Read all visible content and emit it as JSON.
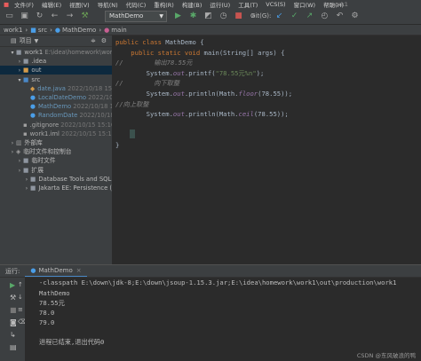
{
  "menubar": {
    "items": [
      "文件(F)",
      "编辑(E)",
      "视图(V)",
      "导航(N)",
      "代码(C)",
      "重构(R)",
      "构建(B)",
      "运行(U)",
      "工具(T)",
      "VCS(S)",
      "窗口(W)",
      "帮助(H)"
    ],
    "window_title": "work1"
  },
  "toolbar": {
    "run_config": "MathDemo",
    "git_label": "Git(G):"
  },
  "breadcrumbs": [
    "work1",
    "src",
    "MathDemo",
    "main"
  ],
  "project": {
    "header": "项目",
    "tree": [
      {
        "label": "work1",
        "path": "E:\\idea\\homework\\work1",
        "indent": 0,
        "icon": "folder",
        "expanded": true
      },
      {
        "label": ".idea",
        "indent": 1,
        "icon": "folder"
      },
      {
        "label": "out",
        "indent": 1,
        "icon": "folder-orange",
        "selected": true
      },
      {
        "label": "src",
        "indent": 1,
        "icon": "folder-blue",
        "expanded": true
      },
      {
        "label": "date.java",
        "meta": "2022/10/18 15:21 2.7",
        "indent": 2,
        "icon": "java-file"
      },
      {
        "label": "LocalDateDemo",
        "meta": "2022/10/18 15:21 2.7",
        "indent": 2,
        "icon": "class"
      },
      {
        "label": "MathDemo",
        "meta": "2022/10/18 15:16, 1.2",
        "indent": 2,
        "icon": "class"
      },
      {
        "label": "RandomDate",
        "meta": "2022/10/18 15:22",
        "indent": 2,
        "icon": "class"
      },
      {
        "label": ".gitignore",
        "meta": "2022/10/15 15:16, 344 B",
        "indent": 1,
        "icon": "file"
      },
      {
        "label": "work1.iml",
        "meta": "2022/10/15 15:16, 433 B",
        "indent": 1,
        "icon": "file"
      },
      {
        "label": "外部库",
        "indent": 0,
        "icon": "library"
      },
      {
        "label": "临时文件和控制台",
        "indent": 0,
        "icon": "scratch"
      },
      {
        "label": "临时文件",
        "indent": 1,
        "icon": "folder"
      },
      {
        "label": "扩展",
        "indent": 1,
        "icon": "folder"
      },
      {
        "label": "Database Tools and SQL",
        "indent": 2,
        "icon": "folder"
      },
      {
        "label": "Jakarta EE: Persistence (JPA)",
        "indent": 2,
        "icon": "folder"
      }
    ]
  },
  "editor": {
    "lines": [
      [
        [
          "kw",
          "public class "
        ],
        [
          "ty",
          "MathDemo {"
        ]
      ],
      [
        [
          "kw",
          "    public static void "
        ],
        [
          "ty",
          "main(String[] args) {"
        ]
      ],
      [
        [
          "cm",
          "//        输出78.55元"
        ]
      ],
      [
        [
          "ty",
          "        System."
        ],
        [
          "fd",
          "out"
        ],
        [
          "ty",
          ".printf("
        ],
        [
          "st",
          "\"78.55元%n\""
        ],
        [
          "ty",
          ");"
        ]
      ],
      [
        [
          "cm",
          "//        向下取整"
        ]
      ],
      [
        [
          "ty",
          "        System."
        ],
        [
          "fd",
          "out"
        ],
        [
          "ty",
          ".println(Math."
        ],
        [
          "fd",
          "floor"
        ],
        [
          "ty",
          "(78.55));"
        ]
      ],
      [
        [
          "cm",
          "//向上取整"
        ]
      ],
      [
        [
          "ty",
          "        System."
        ],
        [
          "fd",
          "out"
        ],
        [
          "ty",
          ".println(Math."
        ],
        [
          "fd",
          "ceil"
        ],
        [
          "ty",
          "(78.55));"
        ]
      ],
      [
        [
          "ty",
          ""
        ]
      ],
      [
        [
          "ty",
          "    }"
        ]
      ],
      [
        [
          "ty",
          "}"
        ]
      ]
    ]
  },
  "run": {
    "label": "运行:",
    "tab": "MathDemo",
    "command": "-classpath E:\\down\\jdk-8;E:\\down\\jsoup-1.15.3.jar;E:\\idea\\homework\\work1\\out\\production\\work1",
    "output": [
      "  MathDemo",
      "78.55元",
      "78.0",
      "79.0",
      "",
      "进程已结束,退出代码0"
    ]
  },
  "watermark": "CSDN @东风破浪的鸭"
}
